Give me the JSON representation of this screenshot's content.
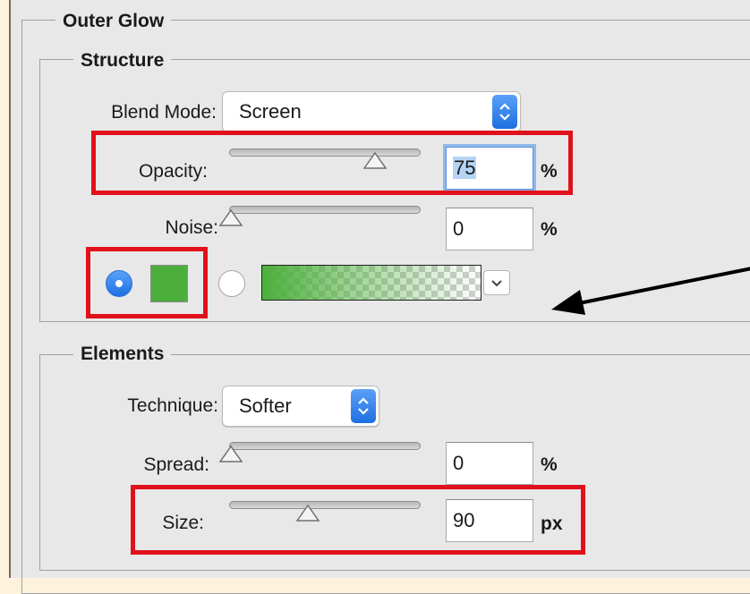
{
  "outer_glow": {
    "title": "Outer Glow",
    "structure": {
      "title": "Structure",
      "blend_mode": {
        "label": "Blend Mode:",
        "value": "Screen"
      },
      "opacity": {
        "label": "Opacity:",
        "value": "75",
        "unit": "%",
        "slider_percent": 75
      },
      "noise": {
        "label": "Noise:",
        "value": "0",
        "unit": "%",
        "slider_percent": 0
      },
      "fill_mode": {
        "selected": "solid-color",
        "solid_color": "#4caf3c",
        "gradient_color": "#4caf3c"
      }
    },
    "elements": {
      "title": "Elements",
      "technique": {
        "label": "Technique:",
        "value": "Softer"
      },
      "spread": {
        "label": "Spread:",
        "value": "0",
        "unit": "%",
        "slider_percent": 0
      },
      "size": {
        "label": "Size:",
        "value": "90",
        "unit": "px",
        "slider_percent": 42
      }
    }
  },
  "annotation_colors": {
    "highlight_box": "#e0111b",
    "arrow": "#000000"
  }
}
